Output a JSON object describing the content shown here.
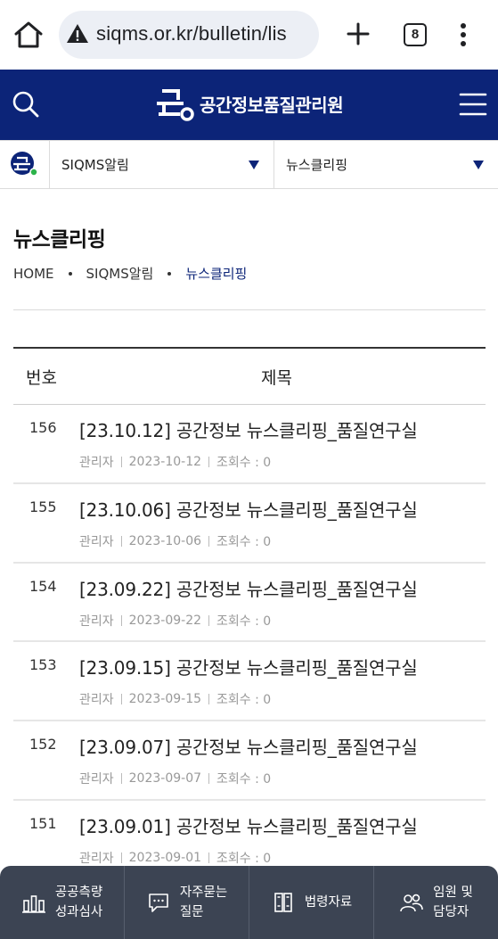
{
  "browser": {
    "url": "siqms.or.kr/bulletin/lis",
    "tab_count": "8"
  },
  "header": {
    "site_name": "공간정보품질관리원",
    "brand_color": "#0c2478"
  },
  "selectors": {
    "category": "SIQMS알림",
    "board": "뉴스클리핑"
  },
  "page": {
    "title": "뉴스클리핑",
    "breadcrumb": [
      "HOME",
      "SIQMS알림",
      "뉴스클리핑"
    ]
  },
  "table": {
    "headers": {
      "no": "번호",
      "title": "제목"
    },
    "rows": [
      {
        "no": "156",
        "title": "[23.10.12] 공간정보 뉴스클리핑_품질연구실",
        "author": "관리자",
        "date": "2023-10-12",
        "views": "조회수 : 0"
      },
      {
        "no": "155",
        "title": "[23.10.06] 공간정보 뉴스클리핑_품질연구실",
        "author": "관리자",
        "date": "2023-10-06",
        "views": "조회수 : 0"
      },
      {
        "no": "154",
        "title": "[23.09.22] 공간정보 뉴스클리핑_품질연구실",
        "author": "관리자",
        "date": "2023-09-22",
        "views": "조회수 : 0"
      },
      {
        "no": "153",
        "title": "[23.09.15] 공간정보 뉴스클리핑_품질연구실",
        "author": "관리자",
        "date": "2023-09-15",
        "views": "조회수 : 0"
      },
      {
        "no": "152",
        "title": "[23.09.07] 공간정보 뉴스클리핑_품질연구실",
        "author": "관리자",
        "date": "2023-09-07",
        "views": "조회수 : 0"
      },
      {
        "no": "151",
        "title": "[23.09.01] 공간정보 뉴스클리핑_품질연구실",
        "author": "관리자",
        "date": "2023-09-01",
        "views": "조회수 : 0"
      }
    ]
  },
  "bottom_nav": [
    {
      "icon": "bar-chart-icon",
      "line1": "공공측량",
      "line2": "성과심사"
    },
    {
      "icon": "chat-bubble-icon",
      "line1": "자주묻는",
      "line2": "질문"
    },
    {
      "icon": "book-icon",
      "line1": "법령자료",
      "line2": ""
    },
    {
      "icon": "people-icon",
      "line1": "임원 및",
      "line2": "담당자"
    }
  ]
}
